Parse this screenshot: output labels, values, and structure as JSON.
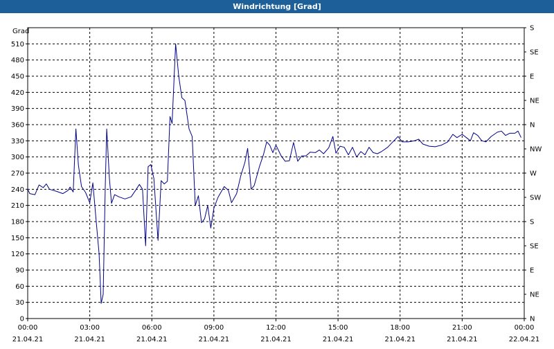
{
  "window": {
    "title": "Windrichtung [Grad]"
  },
  "chart_data": {
    "type": "line",
    "title": "Windrichtung [Grad]",
    "ylabel": "Grad",
    "xlabel": "",
    "ylim": [
      0,
      540
    ],
    "xlim_hours": [
      0,
      24
    ],
    "grid": true,
    "legend": "none",
    "line_color": "#00008b",
    "x_ticks": [
      {
        "time": "00:00",
        "date": "21.04.21"
      },
      {
        "time": "03:00",
        "date": "21.04.21"
      },
      {
        "time": "06:00",
        "date": "21.04.21"
      },
      {
        "time": "09:00",
        "date": "21.04.21"
      },
      {
        "time": "12:00",
        "date": "21.04.21"
      },
      {
        "time": "15:00",
        "date": "21.04.21"
      },
      {
        "time": "18:00",
        "date": "21.04.21"
      },
      {
        "time": "21:00",
        "date": "21.04.21"
      },
      {
        "time": "00:00",
        "date": "22.04.21"
      }
    ],
    "y_ticks": [
      0,
      30,
      60,
      90,
      120,
      150,
      180,
      210,
      240,
      270,
      300,
      330,
      360,
      390,
      420,
      450,
      480,
      510
    ],
    "y2_ticks": [
      {
        "label": "N",
        "value": 0
      },
      {
        "label": "NE",
        "value": 30
      },
      {
        "label": "E",
        "value": 60
      },
      {
        "label": "SE",
        "value": 90
      },
      {
        "label": "S",
        "value": 120
      },
      {
        "label": "SW",
        "value": 150
      },
      {
        "label": "W",
        "value": 180
      },
      {
        "label": "NW",
        "value": 210
      },
      {
        "label": "N",
        "value": 240
      },
      {
        "label": "NE",
        "value": 270
      },
      {
        "label": "E",
        "value": 300
      },
      {
        "label": "SE",
        "value": 330
      },
      {
        "label": "S",
        "value": 360
      }
    ],
    "series": [
      {
        "values": [
          [
            0.0,
            240
          ],
          [
            0.1,
            232
          ],
          [
            0.35,
            230
          ],
          [
            0.55,
            248
          ],
          [
            0.75,
            243
          ],
          [
            0.9,
            250
          ],
          [
            1.05,
            240
          ],
          [
            1.4,
            236
          ],
          [
            1.7,
            232
          ],
          [
            1.95,
            238
          ],
          [
            2.05,
            244
          ],
          [
            2.2,
            235
          ],
          [
            2.33,
            352
          ],
          [
            2.45,
            285
          ],
          [
            2.6,
            245
          ],
          [
            2.8,
            234
          ],
          [
            3.0,
            215
          ],
          [
            3.15,
            252
          ],
          [
            3.3,
            185
          ],
          [
            3.45,
            120
          ],
          [
            3.55,
            28
          ],
          [
            3.65,
            45
          ],
          [
            3.75,
            245
          ],
          [
            3.82,
            352
          ],
          [
            3.95,
            260
          ],
          [
            4.05,
            214
          ],
          [
            4.2,
            230
          ],
          [
            4.4,
            226
          ],
          [
            4.7,
            222
          ],
          [
            5.0,
            226
          ],
          [
            5.25,
            240
          ],
          [
            5.4,
            249
          ],
          [
            5.55,
            240
          ],
          [
            5.7,
            135
          ],
          [
            5.82,
            282
          ],
          [
            5.95,
            286
          ],
          [
            6.1,
            260
          ],
          [
            6.3,
            145
          ],
          [
            6.45,
            256
          ],
          [
            6.6,
            250
          ],
          [
            6.75,
            255
          ],
          [
            6.88,
            375
          ],
          [
            6.98,
            362
          ],
          [
            7.15,
            510
          ],
          [
            7.3,
            450
          ],
          [
            7.45,
            410
          ],
          [
            7.6,
            405
          ],
          [
            7.8,
            352
          ],
          [
            7.95,
            338
          ],
          [
            8.1,
            210
          ],
          [
            8.25,
            228
          ],
          [
            8.4,
            178
          ],
          [
            8.55,
            185
          ],
          [
            8.7,
            210
          ],
          [
            8.85,
            168
          ],
          [
            9.0,
            205
          ],
          [
            9.2,
            225
          ],
          [
            9.5,
            245
          ],
          [
            9.7,
            238
          ],
          [
            9.85,
            215
          ],
          [
            10.1,
            232
          ],
          [
            10.3,
            265
          ],
          [
            10.5,
            290
          ],
          [
            10.63,
            316
          ],
          [
            10.8,
            240
          ],
          [
            10.95,
            247
          ],
          [
            11.2,
            282
          ],
          [
            11.4,
            305
          ],
          [
            11.55,
            328
          ],
          [
            11.7,
            322
          ],
          [
            11.85,
            308
          ],
          [
            12.0,
            322
          ],
          [
            12.25,
            302
          ],
          [
            12.45,
            292
          ],
          [
            12.65,
            293
          ],
          [
            12.85,
            327
          ],
          [
            13.05,
            292
          ],
          [
            13.25,
            302
          ],
          [
            13.45,
            302
          ],
          [
            13.65,
            309
          ],
          [
            13.9,
            308
          ],
          [
            14.1,
            313
          ],
          [
            14.3,
            306
          ],
          [
            14.55,
            317
          ],
          [
            14.75,
            338
          ],
          [
            14.9,
            307
          ],
          [
            15.1,
            320
          ],
          [
            15.3,
            318
          ],
          [
            15.5,
            304
          ],
          [
            15.7,
            318
          ],
          [
            15.9,
            300
          ],
          [
            16.1,
            310
          ],
          [
            16.3,
            304
          ],
          [
            16.5,
            318
          ],
          [
            16.7,
            308
          ],
          [
            16.9,
            306
          ],
          [
            17.1,
            310
          ],
          [
            17.4,
            318
          ],
          [
            17.7,
            330
          ],
          [
            17.9,
            338
          ],
          [
            18.1,
            328
          ],
          [
            18.4,
            328
          ],
          [
            18.7,
            330
          ],
          [
            18.9,
            333
          ],
          [
            19.1,
            324
          ],
          [
            19.4,
            320
          ],
          [
            19.7,
            319
          ],
          [
            20.0,
            322
          ],
          [
            20.3,
            328
          ],
          [
            20.55,
            342
          ],
          [
            20.75,
            336
          ],
          [
            21.0,
            342
          ],
          [
            21.2,
            336
          ],
          [
            21.4,
            330
          ],
          [
            21.55,
            345
          ],
          [
            21.75,
            340
          ],
          [
            21.95,
            330
          ],
          [
            22.15,
            328
          ],
          [
            22.4,
            338
          ],
          [
            22.7,
            346
          ],
          [
            22.9,
            348
          ],
          [
            23.1,
            340
          ],
          [
            23.3,
            344
          ],
          [
            23.55,
            344
          ],
          [
            23.7,
            348
          ],
          [
            23.85,
            336
          ]
        ]
      }
    ]
  }
}
